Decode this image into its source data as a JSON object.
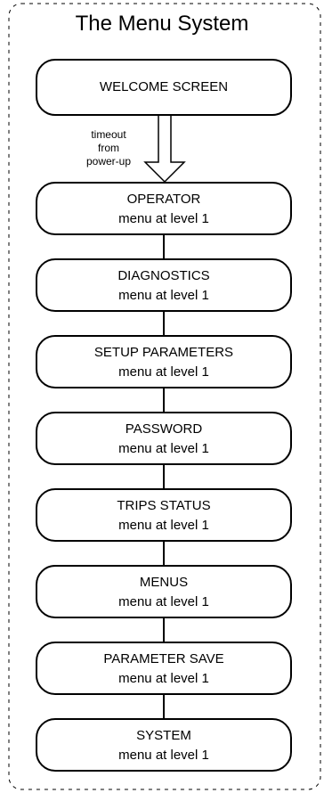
{
  "title": "The Menu System",
  "welcome_label": "WELCOME SCREEN",
  "transition_label": [
    "timeout",
    "from",
    "power-up"
  ],
  "menus": [
    {
      "name": "OPERATOR",
      "subtitle": "menu at level 1"
    },
    {
      "name": "DIAGNOSTICS",
      "subtitle": "menu at level 1"
    },
    {
      "name": "SETUP PARAMETERS",
      "subtitle": "menu at level 1"
    },
    {
      "name": "PASSWORD",
      "subtitle": "menu at level 1"
    },
    {
      "name": "TRIPS STATUS",
      "subtitle": "menu at level 1"
    },
    {
      "name": "MENUS",
      "subtitle": "menu at level 1"
    },
    {
      "name": "PARAMETER SAVE",
      "subtitle": "menu at level 1"
    },
    {
      "name": "SYSTEM",
      "subtitle": "menu at level 1"
    }
  ]
}
